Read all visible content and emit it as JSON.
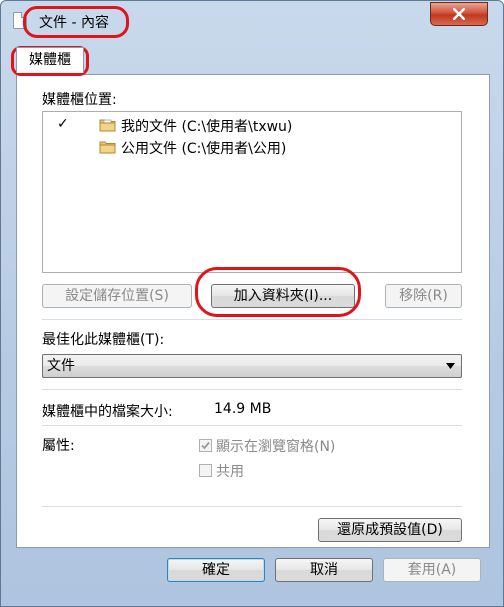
{
  "window": {
    "title": "文件 - 內容"
  },
  "tabs": [
    {
      "label": "媒體櫃"
    }
  ],
  "library": {
    "locations_label": "媒體櫃位置:",
    "locations": [
      {
        "checked": true,
        "text": "我的文件 (C:\\使用者\\txwu)"
      },
      {
        "checked": false,
        "text": "公用文件 (C:\\使用者\\公用)"
      }
    ],
    "set_save_location_label": "設定儲存位置(S)",
    "add_folder_label": "加入資料夾(I)...",
    "remove_label": "移除(R)",
    "optimize_label": "最佳化此媒體櫃(T):",
    "optimize_value": "文件",
    "size_label": "媒體櫃中的檔案大小:",
    "size_value": "14.9 MB",
    "attributes_label": "屬性:",
    "show_in_nav_label": "顯示在瀏覽窗格(N)",
    "show_in_nav_checked": true,
    "shared_label": "共用",
    "shared_checked": false,
    "restore_defaults_label": "還原成預設值(D)"
  },
  "footer": {
    "ok_label": "確定",
    "cancel_label": "取消",
    "apply_label": "套用(A)"
  },
  "colors": {
    "annotation": "#e0141b",
    "close_button": "#c0381f"
  }
}
